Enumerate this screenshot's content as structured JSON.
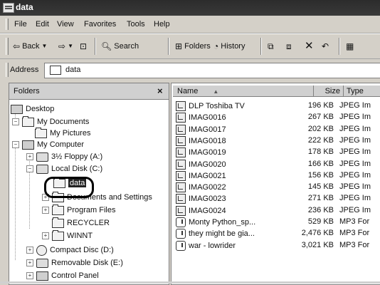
{
  "window": {
    "title": "data"
  },
  "menu": [
    "File",
    "Edit",
    "View",
    "Favorites",
    "Tools",
    "Help"
  ],
  "toolbar": {
    "back_label": "Back",
    "search_label": "Search",
    "folders_label": "Folders",
    "history_label": "History"
  },
  "address": {
    "label": "Address",
    "value": "data"
  },
  "folders_pane": {
    "title": "Folders",
    "close_glyph": "×",
    "tree": [
      {
        "label": "Desktop"
      },
      {
        "label": "My Documents"
      },
      {
        "label": "My Pictures"
      },
      {
        "label": "My Computer"
      },
      {
        "label": "3½ Floppy (A:)"
      },
      {
        "label": "Local Disk (C:)"
      },
      {
        "label": "data"
      },
      {
        "label": "Documents and Settings"
      },
      {
        "label": "Program Files"
      },
      {
        "label": "RECYCLER"
      },
      {
        "label": "WINNT"
      },
      {
        "label": "Compact Disc (D:)"
      },
      {
        "label": "Removable Disk (E:)"
      },
      {
        "label": "Control Panel"
      }
    ]
  },
  "file_list": {
    "columns": {
      "name": "Name",
      "size": "Size",
      "type": "Type"
    },
    "rows": [
      {
        "name": "DLP Toshiba TV",
        "size": "196 KB",
        "type": "JPEG Im",
        "icon": "jpeg-icon"
      },
      {
        "name": "IMAG0016",
        "size": "267 KB",
        "type": "JPEG Im",
        "icon": "jpeg-icon"
      },
      {
        "name": "IMAG0017",
        "size": "202 KB",
        "type": "JPEG Im",
        "icon": "jpeg-icon"
      },
      {
        "name": "IMAG0018",
        "size": "222 KB",
        "type": "JPEG Im",
        "icon": "jpeg-icon"
      },
      {
        "name": "IMAG0019",
        "size": "178 KB",
        "type": "JPEG Im",
        "icon": "jpeg-icon"
      },
      {
        "name": "IMAG0020",
        "size": "166 KB",
        "type": "JPEG Im",
        "icon": "jpeg-icon"
      },
      {
        "name": "IMAG0021",
        "size": "156 KB",
        "type": "JPEG Im",
        "icon": "jpeg-icon"
      },
      {
        "name": "IMAG0022",
        "size": "145 KB",
        "type": "JPEG Im",
        "icon": "jpeg-icon"
      },
      {
        "name": "IMAG0023",
        "size": "271 KB",
        "type": "JPEG Im",
        "icon": "jpeg-icon"
      },
      {
        "name": "IMAG0024",
        "size": "236 KB",
        "type": "JPEG Im",
        "icon": "jpeg-icon"
      },
      {
        "name": "Monty Python_sp...",
        "size": "529 KB",
        "type": "MP3 For",
        "icon": "mp3-icon"
      },
      {
        "name": "they might be gia...",
        "size": "2,476 KB",
        "type": "MP3 For",
        "icon": "mp3-icon"
      },
      {
        "name": "war - lowrider",
        "size": "3,021 KB",
        "type": "MP3 For",
        "icon": "mp3-icon"
      }
    ]
  }
}
